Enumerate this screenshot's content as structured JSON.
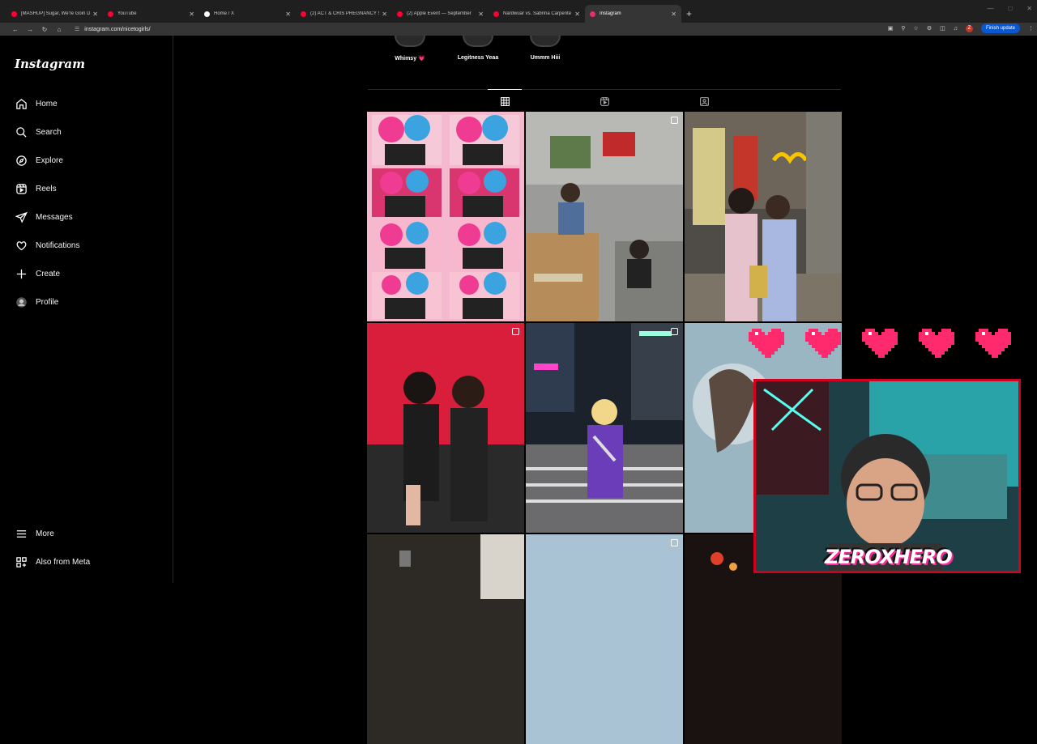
{
  "browser": {
    "tabs": [
      {
        "title": "[MASHUP] Sugar, We're Goin D",
        "favicon_color": "#ff0033",
        "active": false
      },
      {
        "title": "YouTube",
        "favicon_color": "#ff0033",
        "active": false
      },
      {
        "title": "Home / X",
        "favicon_color": "#ffffff",
        "active": false
      },
      {
        "title": "(2) ACT & CRIS PREGNANCY S",
        "favicon_color": "#ff0033",
        "active": false
      },
      {
        "title": "(2) Apple Event — September",
        "favicon_color": "#ff0033",
        "active": false
      },
      {
        "title": "Nardwuar vs. Sabrina Carpente",
        "favicon_color": "#ff0033",
        "active": false
      },
      {
        "title": "Instagram",
        "favicon_color": "#e1306c",
        "active": true
      }
    ],
    "address": "instagram.com/nicetogirls/",
    "update_button": "Finish update",
    "profile_badge": "Z"
  },
  "instagram": {
    "logo": "Instagram",
    "nav": [
      {
        "label": "Home",
        "icon": "home-icon"
      },
      {
        "label": "Search",
        "icon": "search-icon"
      },
      {
        "label": "Explore",
        "icon": "compass-icon"
      },
      {
        "label": "Reels",
        "icon": "reels-icon"
      },
      {
        "label": "Messages",
        "icon": "send-icon"
      },
      {
        "label": "Notifications",
        "icon": "heart-icon"
      },
      {
        "label": "Create",
        "icon": "plus-icon"
      },
      {
        "label": "Profile",
        "icon": "avatar-icon"
      }
    ],
    "footer_nav": [
      {
        "label": "More",
        "icon": "menu-icon"
      },
      {
        "label": "Also from Meta",
        "icon": "meta-icon"
      }
    ],
    "highlights": [
      {
        "label": "Whimsy 💗"
      },
      {
        "label": "Legitness Yeaa"
      },
      {
        "label": "Ummm Hiii"
      }
    ],
    "profile_tabs": [
      {
        "name": "posts",
        "icon": "grid-icon",
        "active": true
      },
      {
        "name": "reels",
        "icon": "reels-icon",
        "active": false
      },
      {
        "name": "tagged",
        "icon": "tagged-icon",
        "active": false
      }
    ],
    "posts": [
      {
        "desc": "photo booth strip pink",
        "multi": false
      },
      {
        "desc": "room with boxes",
        "multi": true
      },
      {
        "desc": "street with mcdonalds",
        "multi": false
      },
      {
        "desc": "two girls red wall",
        "multi": true
      },
      {
        "desc": "night city crossing",
        "multi": true
      },
      {
        "desc": "blurry blue portrait",
        "multi": false
      },
      {
        "desc": "dark building",
        "multi": false
      },
      {
        "desc": "sky",
        "multi": true
      },
      {
        "desc": "night street",
        "multi": false
      }
    ]
  },
  "overlay": {
    "brand": "ZEROXHERO",
    "hearts": 5,
    "accent": "#ff2a6d"
  }
}
